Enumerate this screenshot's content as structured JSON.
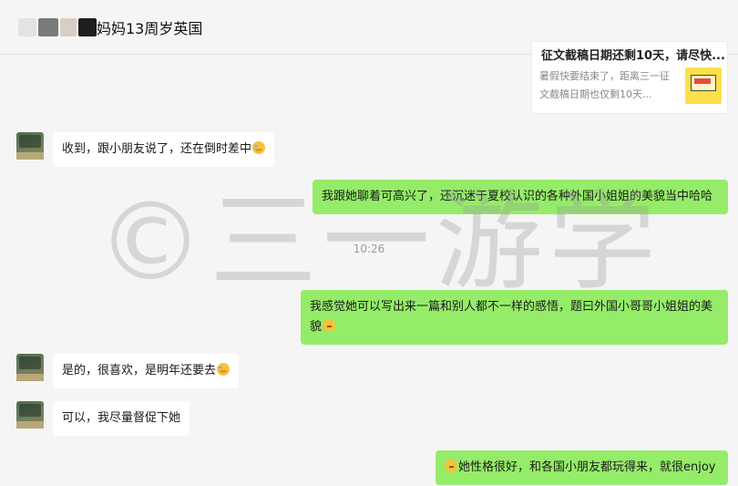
{
  "header": {
    "title": "妈妈13周岁英国"
  },
  "link_card": {
    "title": "征文截稿日期还剩10天，请尽快...",
    "description": "暑假快要结束了，距离三一征文截稿日期也仅剩10天..."
  },
  "messages": [
    {
      "side": "left",
      "text": "收到，跟小朋友说了，还在倒时差中",
      "emoji": "laugh-cry-emoji"
    },
    {
      "side": "right",
      "text": "我跟她聊着可高兴了，还沉迷于夏校认识的各种外国小姐姐的美貌当中哈哈"
    },
    {
      "side": "right",
      "text": "我感觉她可以写出来一篇和别人都不一样的感悟，题曰外国小哥哥小姐姐的美貌",
      "emoji": "thinking-emoji"
    },
    {
      "side": "left",
      "text": "是的，很喜欢，是明年还要去",
      "emoji": "laugh-cry-emoji"
    },
    {
      "side": "left",
      "text": "可以，我尽量督促下她"
    },
    {
      "side": "right",
      "text": "她性格很好，和各国小朋友都玩得来，就很enjoy",
      "emoji": "thinking-emoji"
    }
  ],
  "timestamp": "10:26",
  "watermark": "©三一游学"
}
